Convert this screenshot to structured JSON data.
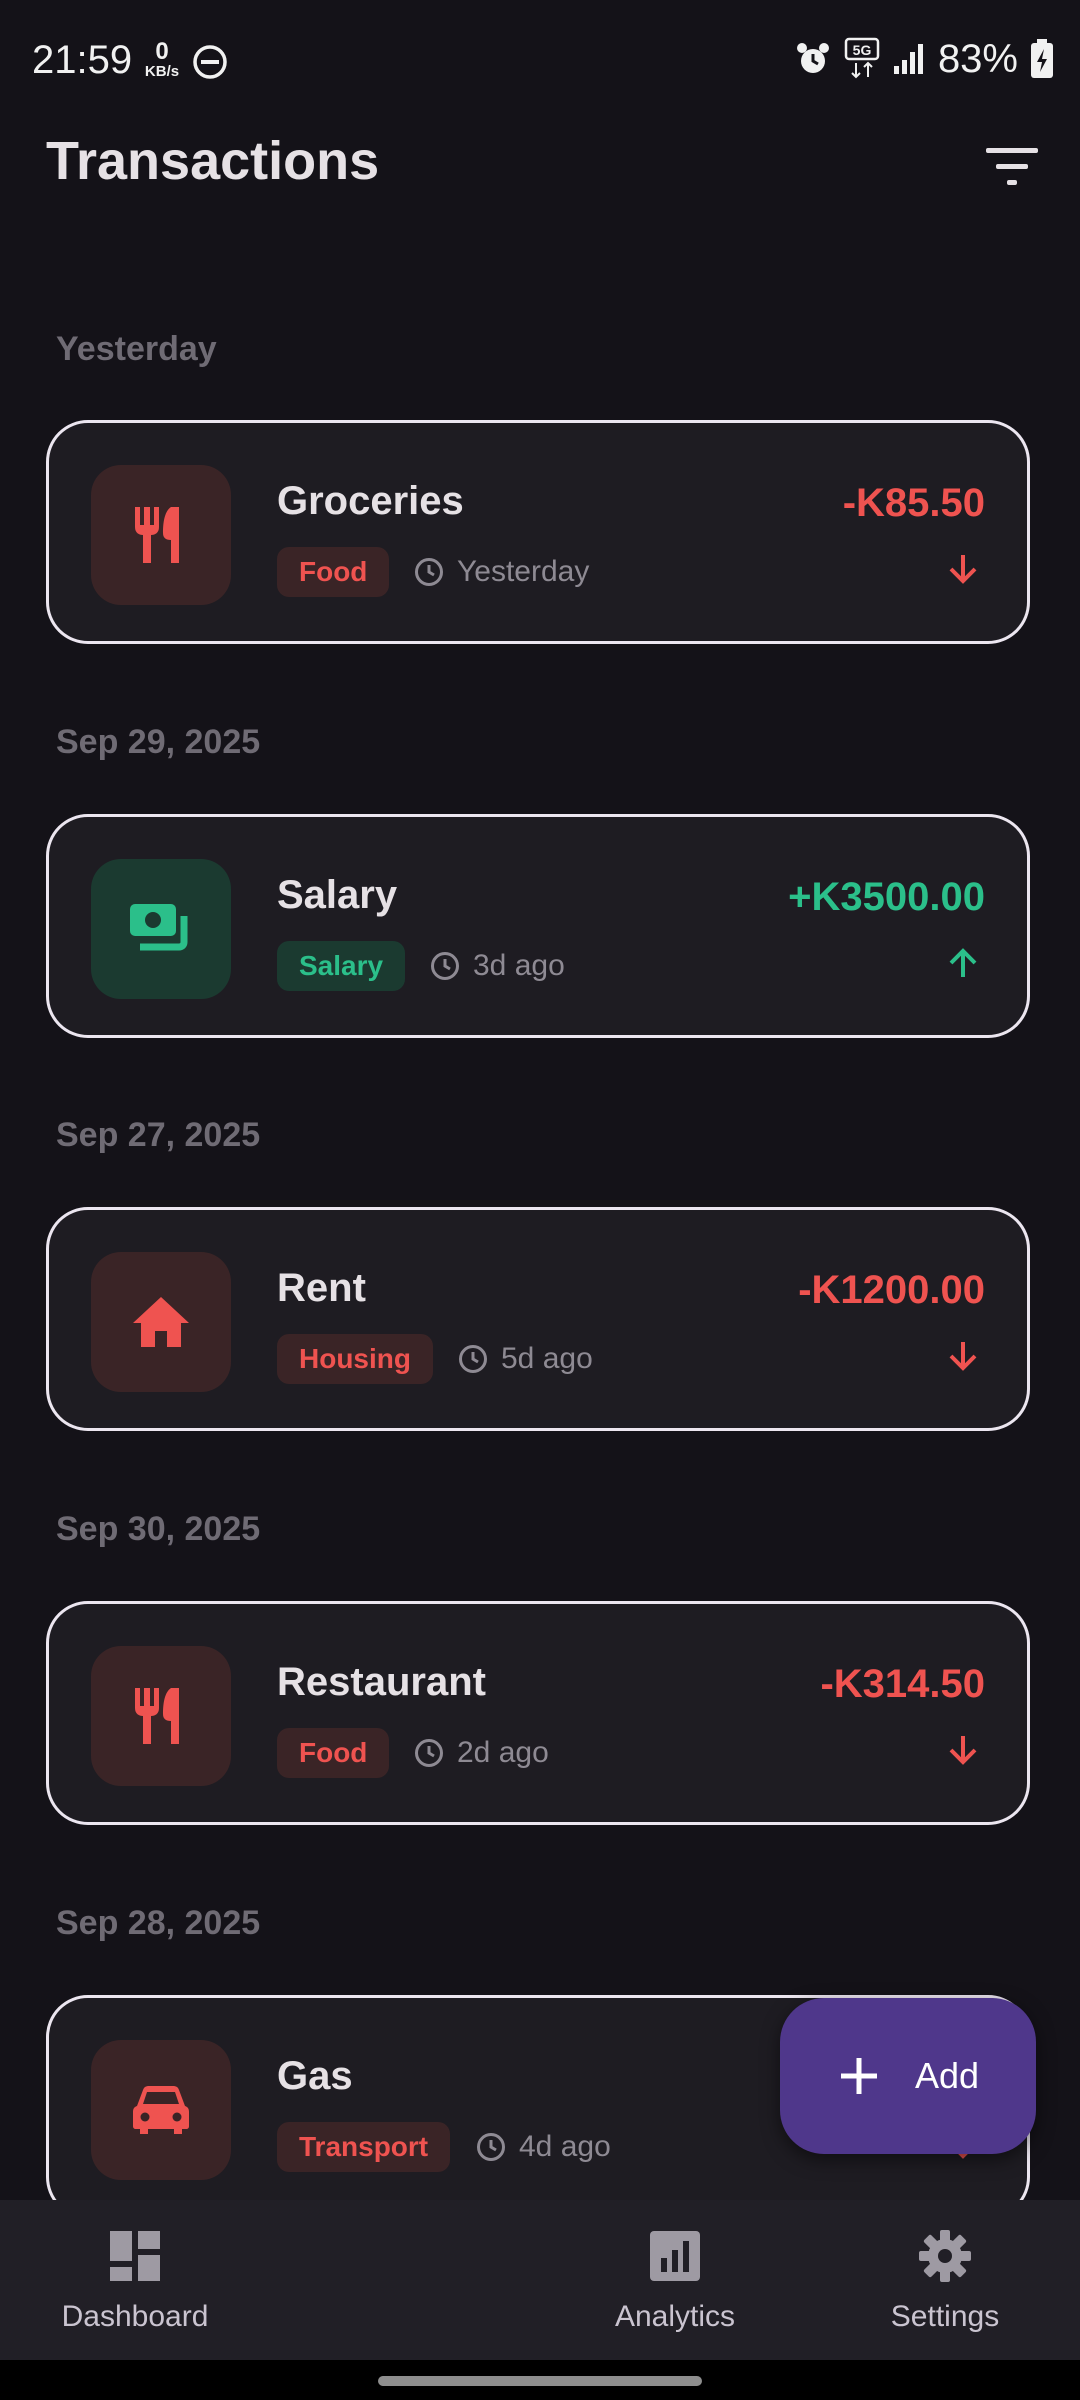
{
  "status_bar": {
    "time": "21:59",
    "net_speed_value": "0",
    "net_speed_unit": "KB/s",
    "network_badge": "5G",
    "battery_percent": "83%"
  },
  "header": {
    "title": "Transactions",
    "filter_icon": "filter-list-icon"
  },
  "sections": [
    {
      "label": "Yesterday",
      "transaction": {
        "title": "Groceries",
        "category": "Food",
        "time": "Yesterday",
        "amount": "-K85.50",
        "type": "expense",
        "icon": "restaurant-icon"
      }
    },
    {
      "label": "Sep 29, 2025",
      "transaction": {
        "title": "Salary",
        "category": "Salary",
        "time": "3d ago",
        "amount": "+K3500.00",
        "type": "income",
        "icon": "payments-icon"
      }
    },
    {
      "label": "Sep 27, 2025",
      "transaction": {
        "title": "Rent",
        "category": "Housing",
        "time": "5d ago",
        "amount": "-K1200.00",
        "type": "expense",
        "icon": "home-icon"
      }
    },
    {
      "label": "Sep 30, 2025",
      "transaction": {
        "title": "Restaurant",
        "category": "Food",
        "time": "2d ago",
        "amount": "-K314.50",
        "type": "expense",
        "icon": "restaurant-icon"
      }
    },
    {
      "label": "Sep 28, 2025",
      "transaction": {
        "title": "Gas",
        "category": "Transport",
        "time": "4d ago",
        "amount": "",
        "type": "expense",
        "icon": "car-icon"
      }
    }
  ],
  "fab": {
    "label": "Add",
    "icon": "plus-icon"
  },
  "bottom_nav": {
    "items": [
      {
        "label": "Dashboard",
        "icon": "dashboard-icon"
      },
      {
        "label": "Analytics",
        "icon": "analytics-icon"
      },
      {
        "label": "Settings",
        "icon": "settings-icon"
      }
    ]
  },
  "colors": {
    "background": "#141218",
    "card": "#1e1c22",
    "expense": "#ef5350",
    "income": "#2bbf8a",
    "fab": "#4f378b",
    "nav": "#211f26"
  }
}
